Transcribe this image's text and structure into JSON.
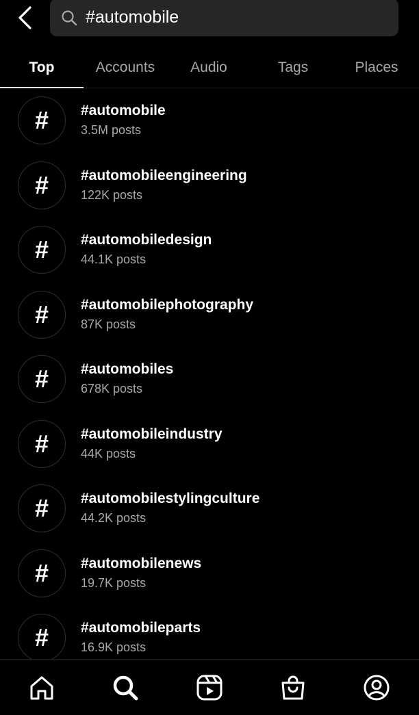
{
  "search": {
    "query": "#automobile"
  },
  "tabs": [
    {
      "label": "Top",
      "active": true
    },
    {
      "label": "Accounts",
      "active": false
    },
    {
      "label": "Audio",
      "active": false
    },
    {
      "label": "Tags",
      "active": false
    },
    {
      "label": "Places",
      "active": false
    }
  ],
  "results": [
    {
      "icon": "#",
      "title": "#automobile",
      "subtitle": "3.5M posts"
    },
    {
      "icon": "#",
      "title": "#automobileengineering",
      "subtitle": "122K posts"
    },
    {
      "icon": "#",
      "title": "#automobiledesign",
      "subtitle": "44.1K posts"
    },
    {
      "icon": "#",
      "title": "#automobilephotography",
      "subtitle": "87K posts"
    },
    {
      "icon": "#",
      "title": "#automobiles",
      "subtitle": "678K posts"
    },
    {
      "icon": "#",
      "title": "#automobileindustry",
      "subtitle": "44K posts"
    },
    {
      "icon": "#",
      "title": "#automobilestylingculture",
      "subtitle": "44.2K posts"
    },
    {
      "icon": "#",
      "title": "#automobilenews",
      "subtitle": "19.7K posts"
    },
    {
      "icon": "#",
      "title": "#automobileparts",
      "subtitle": "16.9K posts"
    }
  ],
  "bottom_nav": [
    {
      "icon": "home-icon"
    },
    {
      "icon": "search-icon",
      "active": true
    },
    {
      "icon": "reels-icon"
    },
    {
      "icon": "shop-icon"
    },
    {
      "icon": "profile-icon"
    }
  ],
  "colors": {
    "background": "#000000",
    "search_field": "#262626",
    "secondary_text": "#a8a8a8"
  }
}
